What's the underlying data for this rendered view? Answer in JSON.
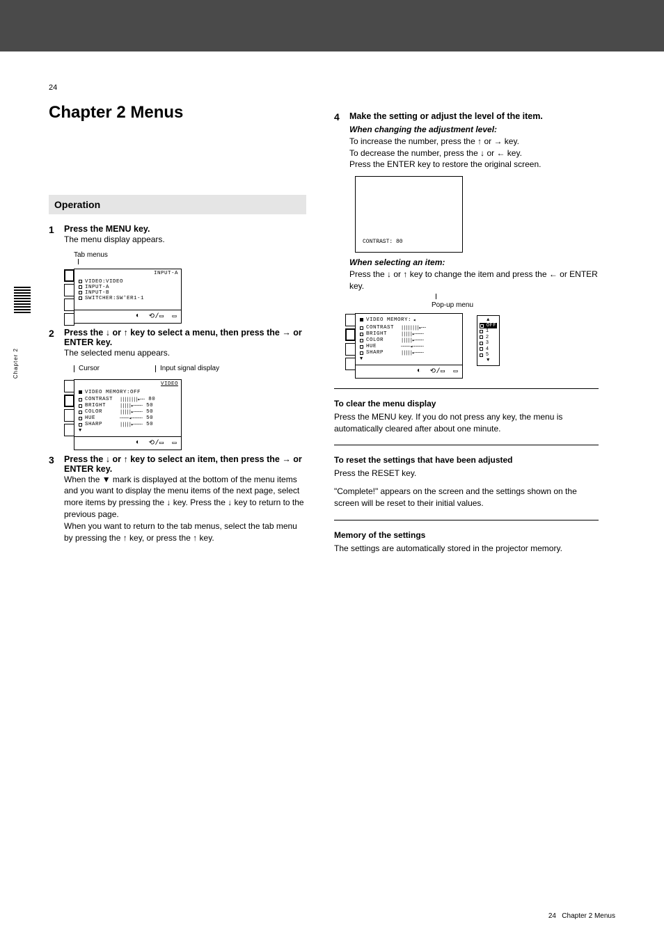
{
  "page_number": "24",
  "chapter": "Chapter 2 Menus",
  "operation": {
    "title": "Operation",
    "step1": {
      "title": "Press the MENU key.",
      "detail": "The menu display appears.",
      "caption_tabs": "Tab menus",
      "menu": {
        "topright": "INPUT-A",
        "items": [
          "VIDEO:VIDEO",
          "INPUT-A",
          "INPUT-B",
          "SWITCHER:SW'ER1-1"
        ]
      }
    },
    "step2": {
      "title_a": "Press the ",
      "title_b": " key to select a menu, then press the ",
      "title_c": " or ENTER key.",
      "detail": "The selected menu appears.",
      "label_signal": "Input signal display",
      "label_cursor": "Cursor",
      "menu": {
        "topright": "VIDEO",
        "header": "VIDEO MEMORY:OFF",
        "rows": [
          {
            "name": "CONTRAST",
            "val": "80"
          },
          {
            "name": "BRIGHT",
            "val": "50"
          },
          {
            "name": "COLOR",
            "val": "50"
          },
          {
            "name": "HUE",
            "val": "50"
          },
          {
            "name": "SHARP",
            "val": "50"
          }
        ]
      }
    },
    "step3": {
      "title_a": "Press the ",
      "title_b": " key to select an item, then press the ",
      "title_c": " or ENTER key.",
      "extra_a": "When the ",
      "extra_b": " mark is displayed at the bottom of the menu items and you want to display the menu items of the next page, select more items by pressing the ",
      "extra_c": " key. Press the ",
      "extra_d": " key to return to the previous page.",
      "extra_e": "When you want to return to the tab menus, select the tab menu by pressing the ",
      "extra_f": " key, or press the ",
      "extra_g": " key.",
      "tri_text": "▼"
    }
  },
  "right": {
    "step4": {
      "title_a": "Make the setting or adjust the level of the item.",
      "whenchanging": "When changing the adjustment level:",
      "inc": "key.",
      "inc_pre": "To increase the number, press the ",
      "dec_pre": "To decrease the number, press the ",
      "dec": "key.",
      "enter_pre": "Press the ENTER key to restore the original screen.",
      "screen_text": "CONTRAST: 80",
      "whenselecting": "When selecting an item:",
      "sel_a": "Press the ",
      "sel_b": " key to change the item and press the ",
      "sel_c": " or ENTER key.",
      "label_popup": "Pop-up menu",
      "menu": {
        "header": "VIDEO MEMORY:",
        "rows": [
          "CONTRAST",
          "BRIGHT",
          "COLOR",
          "HUE",
          "SHARP"
        ],
        "popup": [
          "OFF",
          "1",
          "2",
          "3",
          "4",
          "5"
        ]
      }
    },
    "clear": {
      "title": "To clear the menu display",
      "body": "Press the MENU key. If you do not press any key, the menu is automatically cleared after about one minute."
    },
    "reset": {
      "title": "To reset the settings that have been adjusted",
      "body1": "Press the RESET key.",
      "body2": "\"Complete!\" appears on the screen and the settings shown on the screen will be reset to their initial values."
    },
    "memory": {
      "title": "Memory of the settings",
      "body": "The settings are automatically stored in the projector memory."
    }
  },
  "footer": "Chapter 2  Menus",
  "sidelabel": "Chapter 2"
}
